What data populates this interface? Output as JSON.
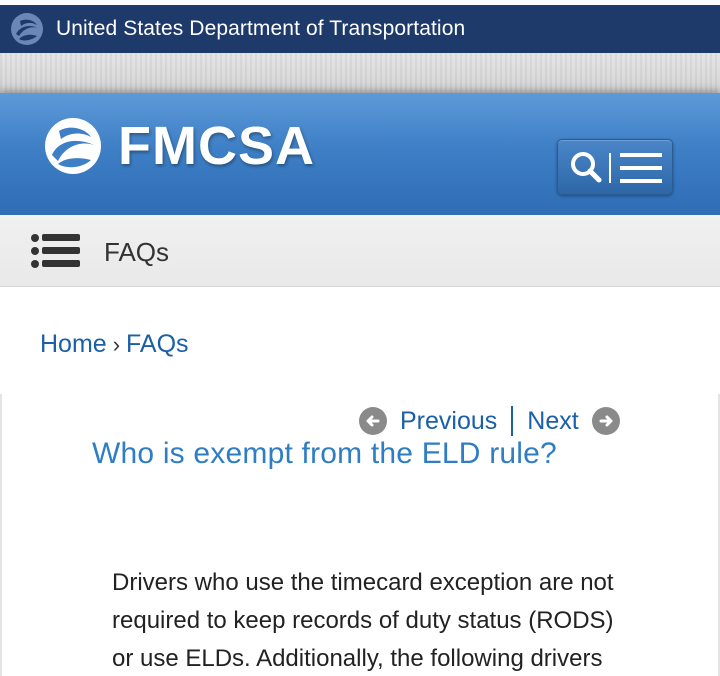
{
  "dot_bar": {
    "title": "United States Department of Transportation",
    "logo_icon": "dot-swirl-icon",
    "background": "#1d3a6b"
  },
  "header": {
    "brand": "FMCSA",
    "logo_icon": "fmcsa-swirl-icon",
    "search_icon": "search-icon",
    "menu_icon": "hamburger-menu-icon",
    "background": "#3e7fc6"
  },
  "subnav": {
    "icon": "list-icon",
    "label": "FAQs"
  },
  "breadcrumb": {
    "home": "Home",
    "separator": "›",
    "current": "FAQs"
  },
  "pager": {
    "previous": "Previous",
    "next": "Next",
    "previous_icon": "arrow-left-circle-icon",
    "next_icon": "arrow-right-circle-icon"
  },
  "faq": {
    "question": "Who is exempt from the ELD rule?",
    "answer_lines": [
      "Drivers who use the timecard exception are not",
      "required to keep records of duty status (RODS)",
      "or use ELDs. Additionally, the following drivers"
    ]
  },
  "colors": {
    "link": "#1a5fa8",
    "question": "#2f7dc4",
    "text": "#222222"
  }
}
